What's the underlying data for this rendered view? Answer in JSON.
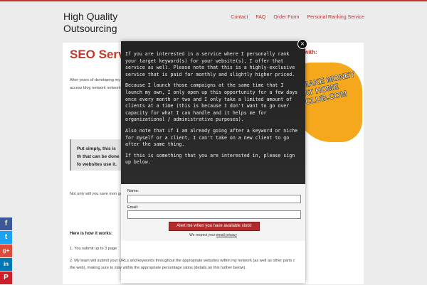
{
  "site": {
    "logo": "High Quality Outsourcing",
    "nav": [
      "Contact",
      "FAQ",
      "Order Form",
      "Personal Ranking Service"
    ]
  },
  "content": {
    "title": "SEO Service",
    "para1": "After years of developing my finally feel comfortable offering website (which is the website beyond what I teach in my private access blog network network and has incredible",
    "highlight": "Put simply, this is th that can be done fo websites use it.",
    "para2": "Not only will you save mon got this whole process setu well.",
    "how_heading": "Here is how it works:",
    "step1": "1. You submit up to 3 page",
    "step2": "2. My team will submit your URLs and keywords throughout the appropriate websites within my network (as well as other parts of the web), making sure to stay within the appropriate percentage ratios (details on this further below)."
  },
  "sidebar": {
    "title": "with:",
    "banner_text": "MAKE MONEY AT HOME CLUB.COM"
  },
  "social": {
    "icons": [
      "facebook-icon",
      "twitter-icon",
      "google-plus-icon",
      "linkedin-icon",
      "pinterest-icon"
    ],
    "labels": [
      "f",
      "t",
      "g+",
      "in",
      "P"
    ],
    "colors": [
      "#3b5998",
      "#1da1f2",
      "#dd4b39",
      "#0077b5",
      "#cb2027"
    ]
  },
  "modal": {
    "para1": "If you are interested in a service where I personally rank your target keyword(s) for your website(s), I offer that service as well. Please note that this is a highly-exclusive service that is paid for monthly and slightly higher priced.",
    "para2": "Because I launch those campaigns at the same time that I launch my own, I only open up this opportunity for a few days once every month or two and I only take a limited amount of clients at a time (this is because I don't want to go over capacity for what I can handle and it helps me for organizational / administrative purposes).",
    "para3": "Also note that if I am already going after a keyword or niche for myself or a client, I can't take on a new client to go after the same thing.",
    "para4": "If this is something that you are interested in, please sign up below.",
    "name_label": "Name:",
    "email_label": "Email:",
    "name_value": "",
    "email_value": "",
    "submit_label": "Alert me when you have available slots!",
    "privacy_prefix": "We respect your",
    "privacy_link": "email privacy",
    "close_label": "×"
  },
  "colors": {
    "accent": "#c0392b",
    "modal_bg": "#222222"
  }
}
